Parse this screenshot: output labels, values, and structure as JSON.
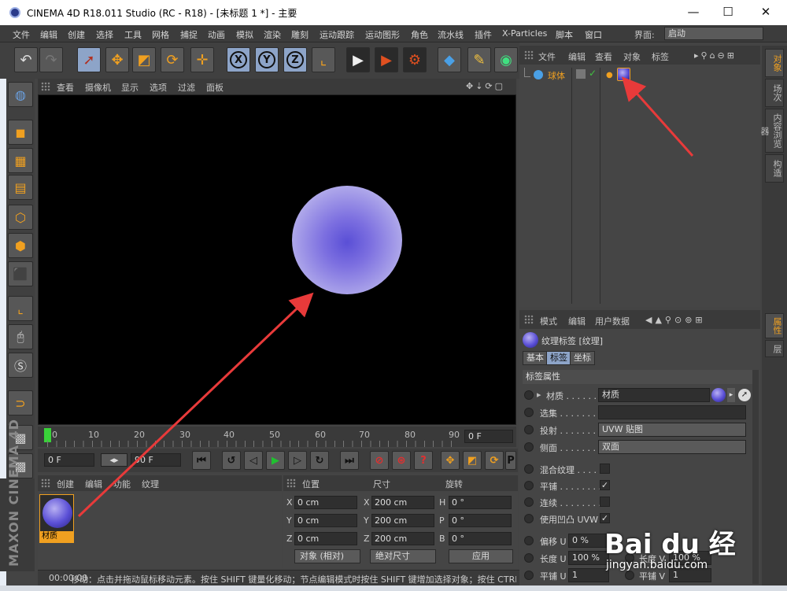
{
  "window": {
    "title": "CINEMA 4D R18.011 Studio (RC - R18) - [未标题 1 *] - 主要",
    "controls": [
      "—",
      "☐",
      "✕"
    ]
  },
  "menubar": {
    "items": [
      "文件",
      "编辑",
      "创建",
      "选择",
      "工具",
      "网格",
      "捕捉",
      "动画",
      "模拟",
      "渲染",
      "雕刻",
      "运动跟踪",
      "运动图形",
      "角色",
      "流水线",
      "插件",
      "X-Particles",
      "脚本",
      "窗口"
    ],
    "layout_label": "界面:",
    "layout_value": "启动"
  },
  "viewport": {
    "menu": [
      "查看",
      "摄像机",
      "显示",
      "选项",
      "过滤",
      "面板"
    ],
    "nav_icons": "✥⇣⟳▢"
  },
  "timeline": {
    "ticks": [
      "0",
      "10",
      "20",
      "30",
      "40",
      "50",
      "60",
      "70",
      "80",
      "90"
    ],
    "frame": "0 F"
  },
  "transport": {
    "start": "0 F",
    "end": "90 F"
  },
  "material_manager": {
    "menu": [
      "创建",
      "编辑",
      "功能",
      "纹理"
    ],
    "material_name": "材质"
  },
  "coordinates": {
    "headers": [
      "位置",
      "尺寸",
      "旋转"
    ],
    "rows": [
      {
        "pos_axis": "X",
        "pos": "0 cm",
        "size_axis": "X",
        "size": "200 cm",
        "rot_axis": "H",
        "rot": "0 °"
      },
      {
        "pos_axis": "Y",
        "pos": "0 cm",
        "size_axis": "Y",
        "size": "200 cm",
        "rot_axis": "P",
        "rot": "0 °"
      },
      {
        "pos_axis": "Z",
        "pos": "0 cm",
        "size_axis": "Z",
        "size": "200 cm",
        "rot_axis": "B",
        "rot": "0 °"
      }
    ],
    "mode_dropdown": "对象 (相对)",
    "size_dropdown": "绝对尺寸",
    "apply_button": "应用"
  },
  "status": {
    "time": "00:00:00",
    "message": "移动：点击并拖动鼠标移动元素。按住 SHIFT 键量化移动；节点编辑模式时按住 SHIFT 键增加选择对象；按住 CTRL 键"
  },
  "object_manager": {
    "menu": [
      "文件",
      "编辑",
      "查看",
      "对象",
      "标签"
    ],
    "object_name": "球体"
  },
  "right_tabs": {
    "top": [
      "对象",
      "场次",
      "内容浏览器",
      "构造"
    ],
    "bottom": [
      "属性",
      "层"
    ]
  },
  "attribute_manager": {
    "menu": [
      "模式",
      "编辑",
      "用户数据"
    ],
    "title": "纹理标签 [纹理]",
    "tabs": [
      "基本",
      "标签",
      "坐标"
    ],
    "section": "标签属性",
    "rows": {
      "material_label": "材质 . . . . . . . .",
      "material_value": "材质",
      "selection_label": "选集 . . . . . . . .",
      "projection_label": "投射 . . . . . . . .",
      "projection_value": "UVW 贴图",
      "side_label": "侧面 . . . . . . . .",
      "side_value": "双面",
      "mix_label": "混合纹理 . . . . . .",
      "tile_label": "平铺 . . . . . . . .",
      "seamless_label": "连续 . . . . . . . .",
      "bump_uvw_label": "使用凹凸 UVW",
      "offset_u_label": "偏移 U",
      "offset_u_value": "0 %",
      "length_u_label": "长度 U",
      "length_u_value": "100 %",
      "length_v_label": "长度 V",
      "length_v_value": "100 %",
      "tiles_u_label": "平铺 U",
      "tiles_u_value": "1",
      "tiles_v_label": "平铺 V",
      "tiles_v_value": "1"
    }
  },
  "watermark": {
    "logo": "Bai du 经",
    "url": "jingyan.baidu.com"
  },
  "colors": {
    "accent": "#f0a020",
    "selected_button": "#8da4c8",
    "annotation_arrow": "#e83a3a"
  }
}
